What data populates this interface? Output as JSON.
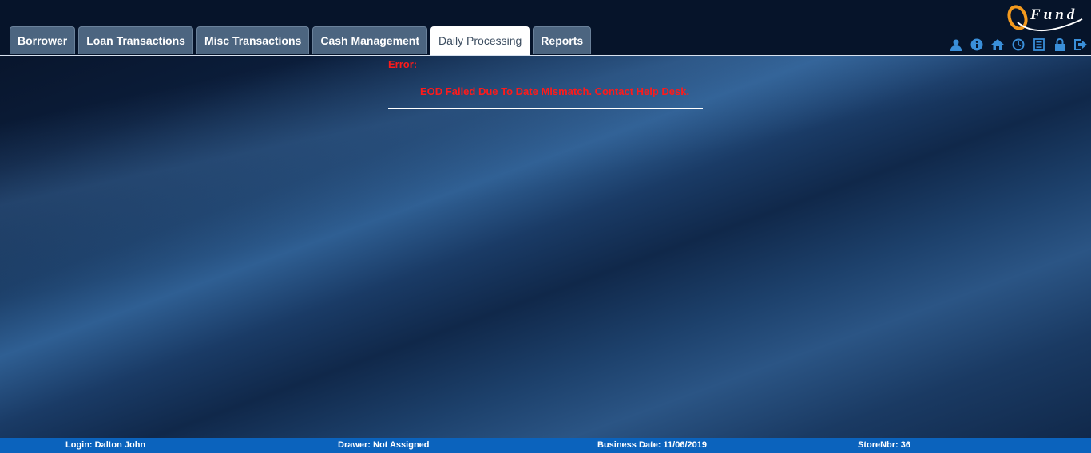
{
  "header": {
    "logo_text": "Fund",
    "tabs": [
      {
        "label": "Borrower",
        "active": false
      },
      {
        "label": "Loan Transactions",
        "active": false
      },
      {
        "label": "Misc Transactions",
        "active": false
      },
      {
        "label": "Cash Management",
        "active": false
      },
      {
        "label": "Daily Processing",
        "active": true
      },
      {
        "label": "Reports",
        "active": false
      }
    ],
    "toolbar_icons": [
      "user-icon",
      "info-icon",
      "home-icon",
      "clock-icon",
      "list-icon",
      "lock-icon",
      "logout-icon"
    ],
    "icon_color": "#3a8fd9"
  },
  "error": {
    "label": "Error:",
    "message": "EOD Failed Due To Date Mismatch. Contact Help Desk.",
    "color": "#ff1a1a"
  },
  "status": {
    "login": "Login: Dalton John",
    "drawer": "Drawer: Not Assigned",
    "business_date": "Business Date: 11/06/2019",
    "store": "StoreNbr: 36",
    "bar_color": "#0b63bd"
  }
}
